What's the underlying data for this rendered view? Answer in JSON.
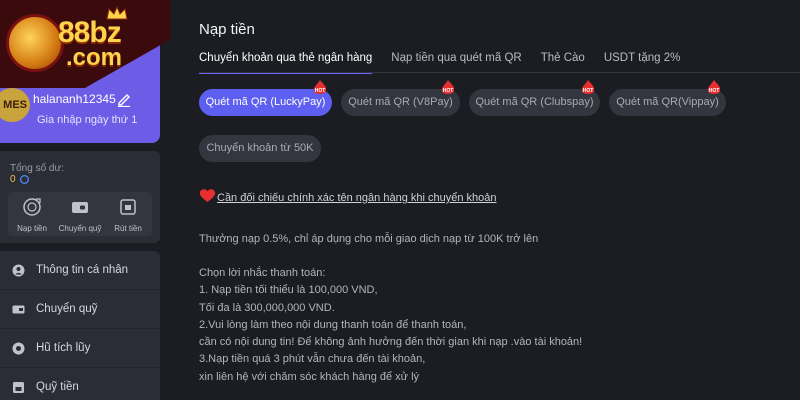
{
  "sidebar": {
    "logo": {
      "line1": "88bz",
      "line2": ".com"
    },
    "profile": {
      "avatar_text": "MES",
      "username": "halananh12345",
      "join_day": "Gia nhập ngày thứ 1"
    },
    "balance": {
      "label": "Tổng số dư:",
      "value": "0"
    },
    "actions": [
      {
        "label": "Nạp tiền",
        "icon": "deposit-icon"
      },
      {
        "label": "Chuyển quỹ",
        "icon": "wallet-icon"
      },
      {
        "label": "Rút tiền",
        "icon": "withdraw-icon"
      }
    ],
    "menu": [
      {
        "label": "Thông tin cá nhân",
        "icon": "user-icon"
      },
      {
        "label": "Chuyển quỹ",
        "icon": "wallet-icon"
      },
      {
        "label": "Hũ tích lũy",
        "icon": "jar-icon"
      },
      {
        "label": "Quỹ tiền",
        "icon": "fund-icon"
      }
    ]
  },
  "main": {
    "title": "Nạp tiền",
    "tabs": [
      {
        "label": "Chuyển khoản qua thẻ ngân hàng",
        "active": true
      },
      {
        "label": "Nạp tiền qua quét mã QR",
        "active": false
      },
      {
        "label": "Thẻ Cào",
        "active": false
      },
      {
        "label": "USDT tặng 2%",
        "active": false
      }
    ],
    "methods": [
      {
        "label": "Quét mã QR (LuckyPay)",
        "hot": true,
        "active": true
      },
      {
        "label": "Quét mã QR (V8Pay)",
        "hot": true,
        "active": false
      },
      {
        "label": "Quét mã QR (Clubspay)",
        "hot": true,
        "active": false
      },
      {
        "label": "Quét mã QR(Vippay)",
        "hot": true,
        "active": false
      },
      {
        "label": "Chuyển khoản từ 50K",
        "hot": false,
        "active": false
      }
    ],
    "hot_badge": "HOT",
    "warning_link": "Cần đối chiếu chính xác tên ngân hàng khi chuyển khoản",
    "bonus_text": "Thưởng nạp 0.5%, chỉ áp dụng cho mỗi giao dịch nạp từ 100K trở lên",
    "notes": [
      "Chọn lời nhắc thanh toán:",
      "1. Nạp tiền tối thiểu là 100,000 VND,",
      "Tối đa là 300,000,000 VND.",
      "2.Vui lòng làm theo nội dung thanh toán để thanh toán,",
      "cần có nội dung tin! Để không ảnh hưởng đến thời gian khi nạp .vào tài khoản!",
      "3.Nạp tiền quá 3 phút vẫn chưa đến tài khoản,",
      "xin liên hệ với chăm sóc khách hàng để xử lý"
    ]
  },
  "colors": {
    "accent": "#5c5ff0",
    "profile_bg": "#6d5de6",
    "panel": "#2a2d36",
    "background": "#1b1d23",
    "hot": "#e5302f"
  }
}
